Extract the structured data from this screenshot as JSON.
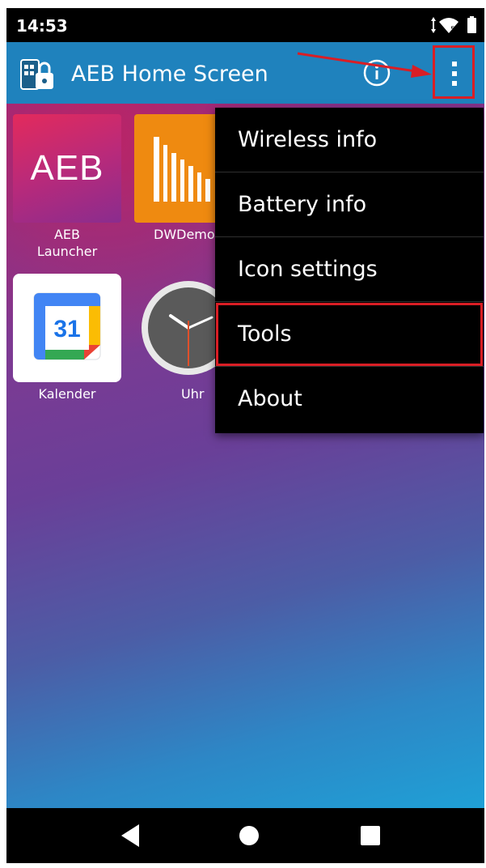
{
  "status_bar": {
    "time": "14:53",
    "icons": [
      "wifi-icon",
      "battery-icon"
    ]
  },
  "app_bar": {
    "title": "AEB Home Screen",
    "icons": [
      "aeb-app-icon",
      "info-icon",
      "more-vert-icon"
    ]
  },
  "apps": [
    {
      "label": "AEB\nLauncher",
      "tile_text": "AEB",
      "icon": "aeb-launcher-icon"
    },
    {
      "label": "DWDemo",
      "icon": "dwdemo-icon"
    },
    {
      "label": "Kalender",
      "tile_text": "31",
      "icon": "calendar-icon"
    },
    {
      "label": "Uhr",
      "icon": "clock-icon"
    }
  ],
  "overflow_menu": {
    "items": [
      "Wireless info",
      "Battery info",
      "Icon settings",
      "Tools",
      "About"
    ],
    "highlighted": "Tools"
  },
  "nav_bar": {
    "icons": [
      "back-icon",
      "home-icon",
      "recents-icon"
    ]
  },
  "colors": {
    "app_bar": "#1f82bd",
    "highlight": "#d91e25",
    "menu_bg": "#000000"
  }
}
